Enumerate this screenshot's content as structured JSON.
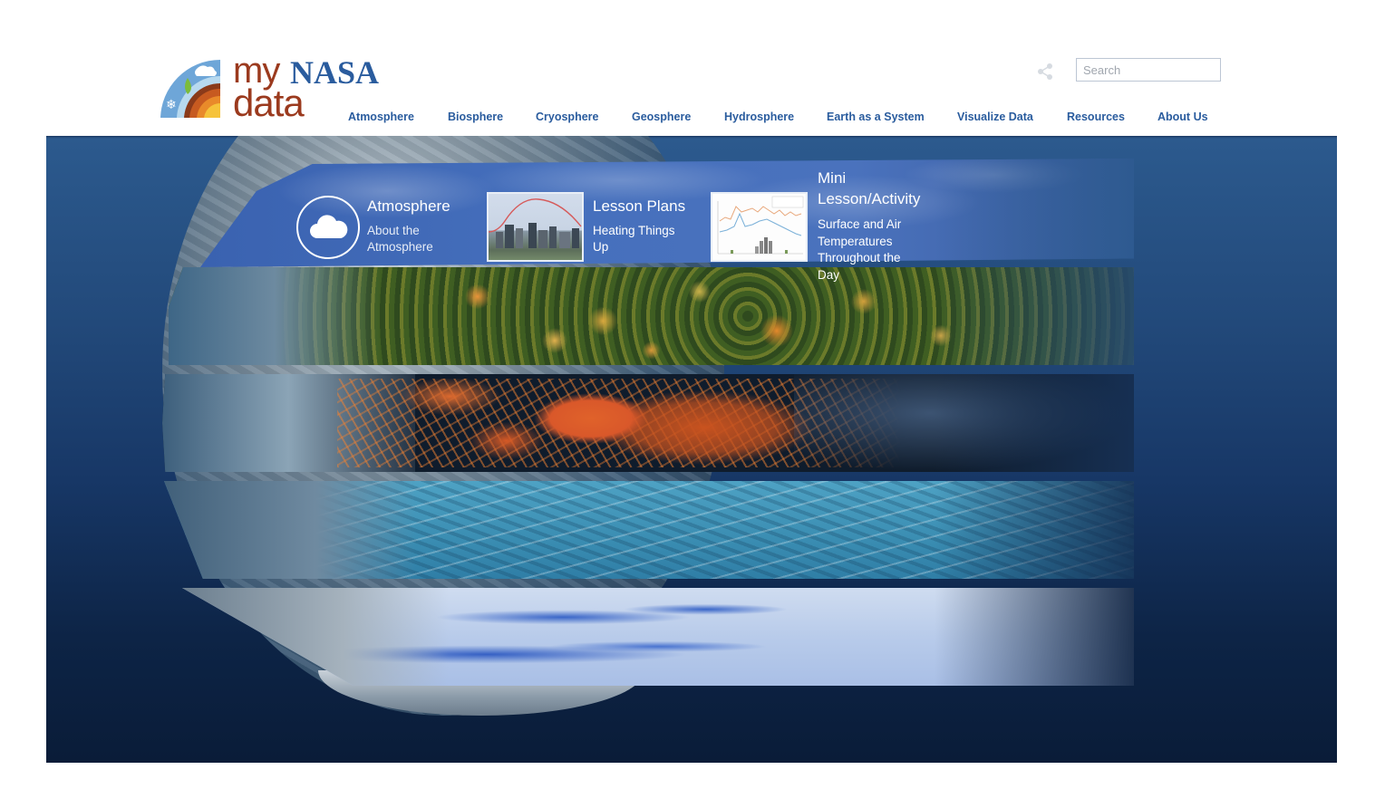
{
  "logo": {
    "my": "my",
    "nasa": "NASA",
    "data": "data"
  },
  "header": {
    "share_icon": "share-icon",
    "search": {
      "placeholder": "Search",
      "value": ""
    }
  },
  "nav": {
    "items": [
      {
        "label": "Atmosphere"
      },
      {
        "label": "Biosphere"
      },
      {
        "label": "Cryosphere"
      },
      {
        "label": "Geosphere"
      },
      {
        "label": "Hydrosphere"
      },
      {
        "label": "Earth as a System"
      },
      {
        "label": "Visualize Data"
      },
      {
        "label": "Resources"
      },
      {
        "label": "About Us"
      }
    ]
  },
  "colors": {
    "brand_blue": "#2a5c9e",
    "brand_rust": "#9b3a1e",
    "hero_top": "#2c5a8e",
    "hero_bottom": "#0a1c38"
  },
  "hero": {
    "bands": [
      {
        "name": "Atmosphere"
      },
      {
        "name": "Biosphere"
      },
      {
        "name": "Geosphere"
      },
      {
        "name": "Hydrosphere"
      },
      {
        "name": "Cryosphere"
      }
    ],
    "atmosphere_card": {
      "icon": "cloud-icon",
      "title": "Atmosphere",
      "subtitle_line1": "About the",
      "subtitle_line2": "Atmosphere"
    },
    "lesson_card": {
      "title": "Lesson Plans",
      "subtitle_line1": "Heating Things",
      "subtitle_line2": "Up"
    },
    "mini_card": {
      "title_line1": "Mini",
      "title_line2": "Lesson/Activity",
      "subtitle_line1": "Surface and Air",
      "subtitle_line2": "Temperatures",
      "subtitle_line3": "Throughout the",
      "subtitle_line4": "Day"
    }
  }
}
